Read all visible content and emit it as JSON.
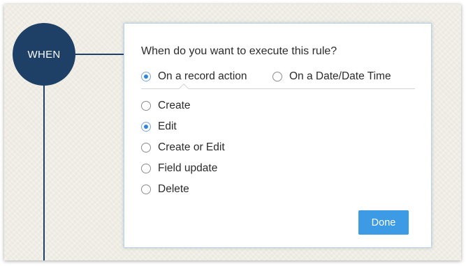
{
  "when_label": "WHEN",
  "question": "When do you want to execute this rule?",
  "trigger_types": [
    {
      "label": "On a record action",
      "checked": true
    },
    {
      "label": "On a Date/Date Time",
      "checked": false
    }
  ],
  "actions": [
    {
      "label": "Create",
      "checked": false
    },
    {
      "label": "Edit",
      "checked": true
    },
    {
      "label": "Create or Edit",
      "checked": false
    },
    {
      "label": "Field update",
      "checked": false
    },
    {
      "label": "Delete",
      "checked": false
    }
  ],
  "done_label": "Done",
  "colors": {
    "circle": "#1e3f66",
    "accent": "#3d9ae4",
    "radio_dot": "#2f86d6",
    "background": "#efede4"
  }
}
